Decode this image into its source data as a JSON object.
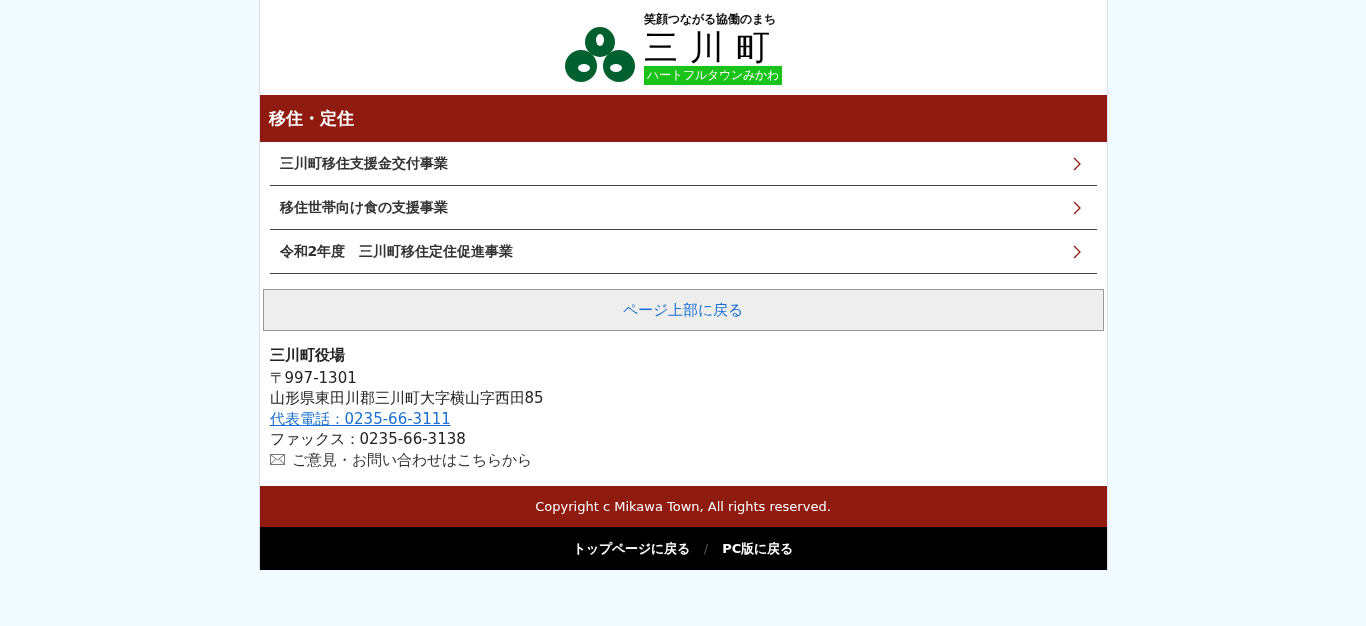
{
  "header": {
    "tagline": "笑顔つながる協働のまち",
    "town_name": "三川町",
    "subtitle": "ハートフルタウンみかわ"
  },
  "section": {
    "title": "移住・定住",
    "items": [
      {
        "label": "三川町移住支援金交付事業"
      },
      {
        "label": "移住世帯向け食の支援事業"
      },
      {
        "label": "令和2年度　三川町移住定住促進事業"
      }
    ]
  },
  "back_to_top": "ページ上部に戻る",
  "office": {
    "name": "三川町役場",
    "postal": "〒997-1301",
    "address": "山形県東田川郡三川町大字横山字西田85",
    "phone_link": "代表電話：0235-66-3111",
    "fax": "ファックス：0235-66-3138",
    "contact_link": "ご意見・お問い合わせはこちらから"
  },
  "copyright": "Copyright c Mikawa Town, All rights reserved.",
  "footer_nav": {
    "links": [
      "トップページに戻る",
      "PC版に戻る"
    ],
    "separator": "/"
  }
}
